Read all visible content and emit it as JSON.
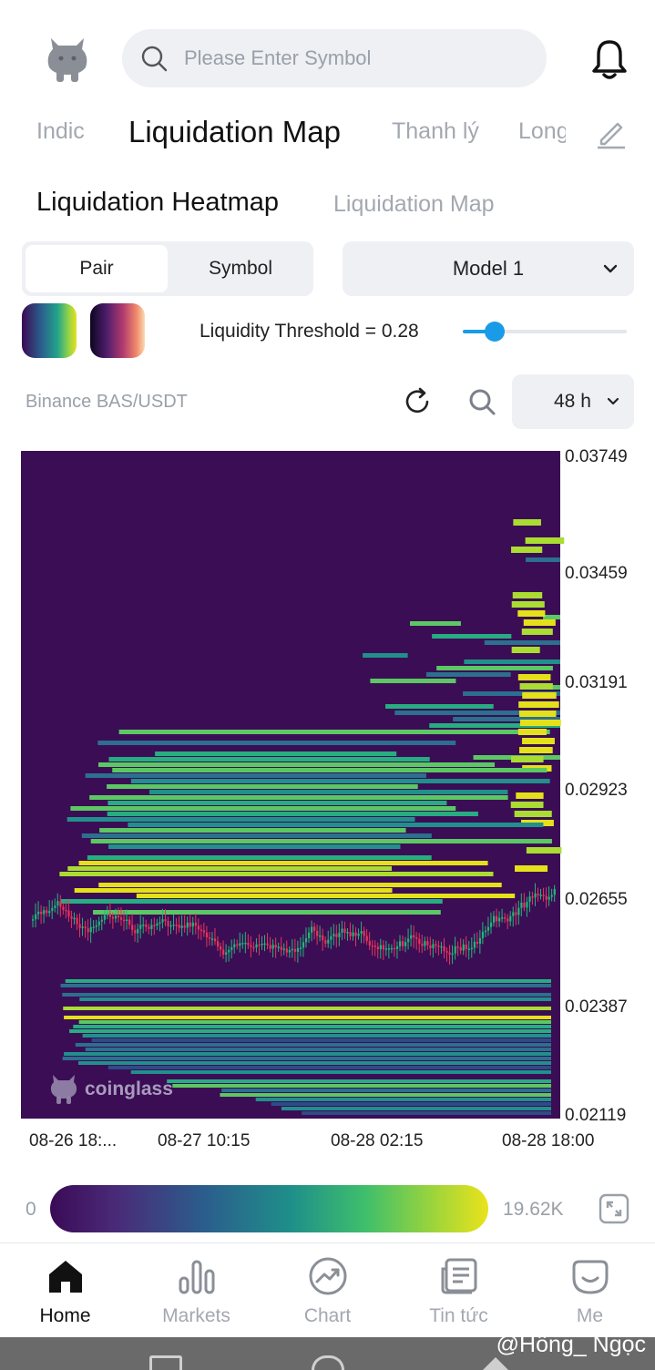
{
  "search": {
    "placeholder": "Please Enter Symbol"
  },
  "top_tabs": [
    {
      "label": "Indic",
      "left": 40
    },
    {
      "label": "Liquidation Map",
      "active": true
    },
    {
      "label": "Thanh lý"
    },
    {
      "label": "Long"
    }
  ],
  "sub_tabs": {
    "active": "Liquidation Heatmap",
    "inactive": "Liquidation Map"
  },
  "segmented": {
    "pair": "Pair",
    "symbol": "Symbol",
    "selected": "Pair"
  },
  "model": {
    "selected": "Model 1"
  },
  "threshold": {
    "label": "Liquidity Threshold = 0.28",
    "value": 0.28
  },
  "exchange": "Binance BAS/USDT",
  "range": {
    "selected": "48 h"
  },
  "chart_data": {
    "type": "heatmap",
    "y_ticks": [
      "0.03749",
      "0.03459",
      "0.03191",
      "0.02923",
      "0.02655",
      "0.02387",
      "0.02119"
    ],
    "x_ticks": [
      "08-26 18:...",
      "08-27 10:15",
      "08-28 02:15",
      "08-28 18:00"
    ],
    "ylim": [
      0.02119,
      0.03749
    ],
    "watermark": "coinglass",
    "background": "#3b0d55",
    "colorbar": {
      "min": "0",
      "max": "19.62K"
    }
  },
  "nav": [
    {
      "label": "Home",
      "icon": "home-icon",
      "active": true
    },
    {
      "label": "Markets",
      "icon": "markets-icon"
    },
    {
      "label": "Chart",
      "icon": "chart-icon"
    },
    {
      "label": "Tin tức",
      "icon": "news-icon"
    },
    {
      "label": "Me",
      "icon": "me-icon"
    }
  ],
  "watermark": "@Hồng_ Ngọc"
}
